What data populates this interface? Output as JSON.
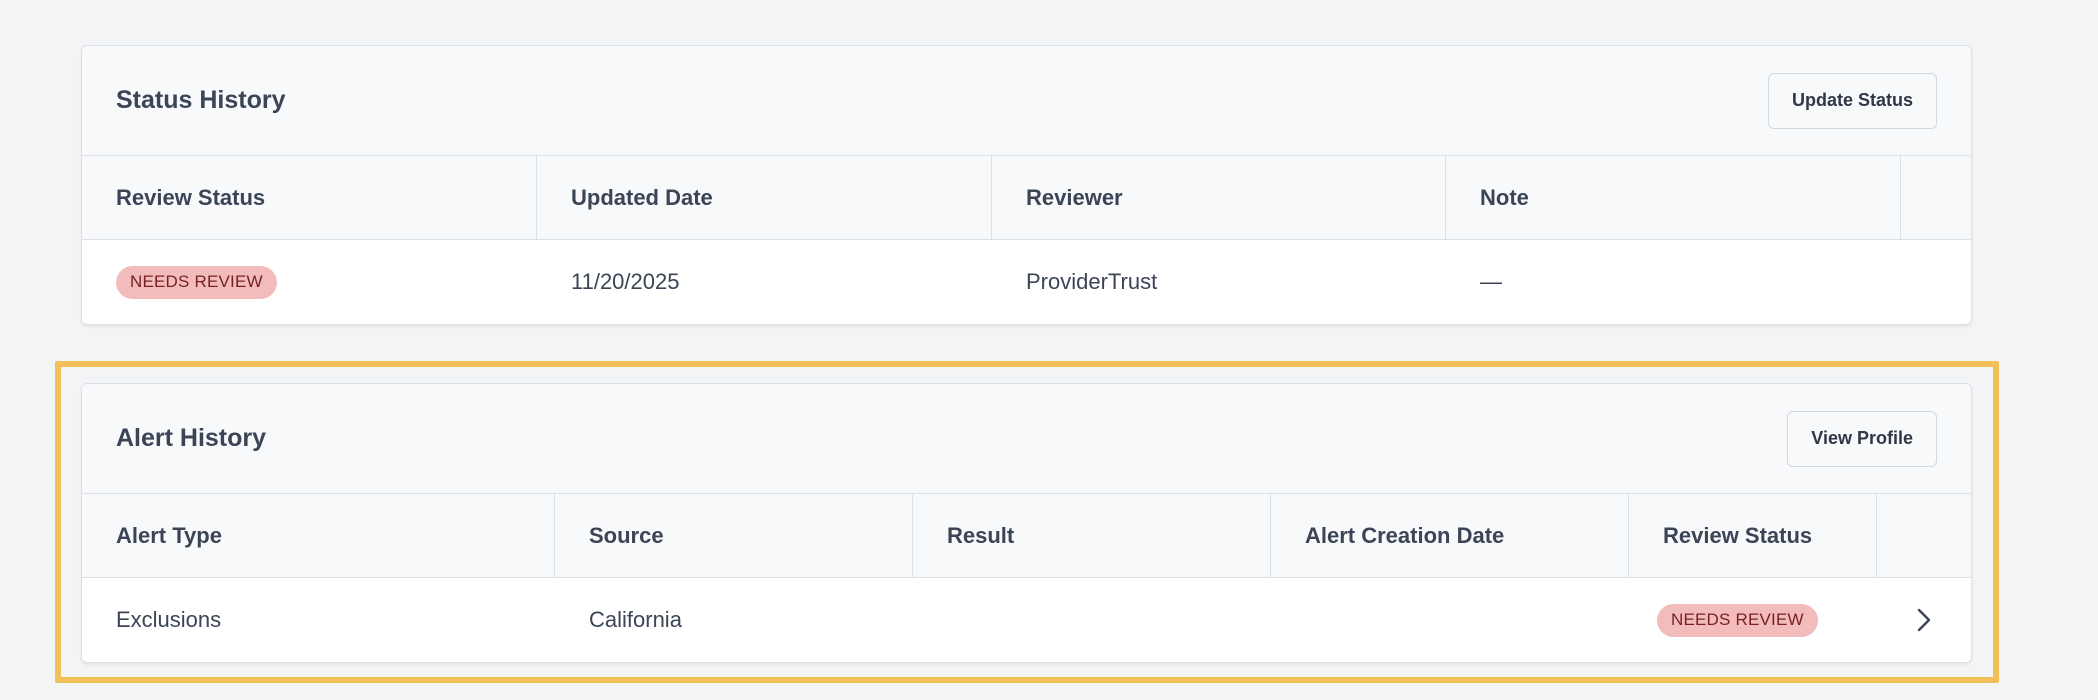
{
  "status_history": {
    "title": "Status History",
    "button_label": "Update Status",
    "columns": [
      "Review Status",
      "Updated Date",
      "Reviewer",
      "Note"
    ],
    "rows": [
      {
        "review_status": "NEEDS REVIEW",
        "updated_date": "11/20/2025",
        "reviewer": "ProviderTrust",
        "note": "—"
      }
    ]
  },
  "alert_history": {
    "title": "Alert History",
    "button_label": "View Profile",
    "columns": [
      "Alert Type",
      "Source",
      "Result",
      "Alert Creation Date",
      "Review Status"
    ],
    "rows": [
      {
        "alert_type": "Exclusions",
        "source": "California",
        "result": "",
        "alert_creation_date": "",
        "review_status": "NEEDS REVIEW"
      }
    ]
  },
  "colors": {
    "badge_bg": "#f2bcbc",
    "badge_text": "#7a1f1f",
    "highlight_border": "#f2bf5b",
    "page_bg": "#f3f4f6"
  },
  "icons": {
    "row_action": "chevron-right-icon"
  }
}
